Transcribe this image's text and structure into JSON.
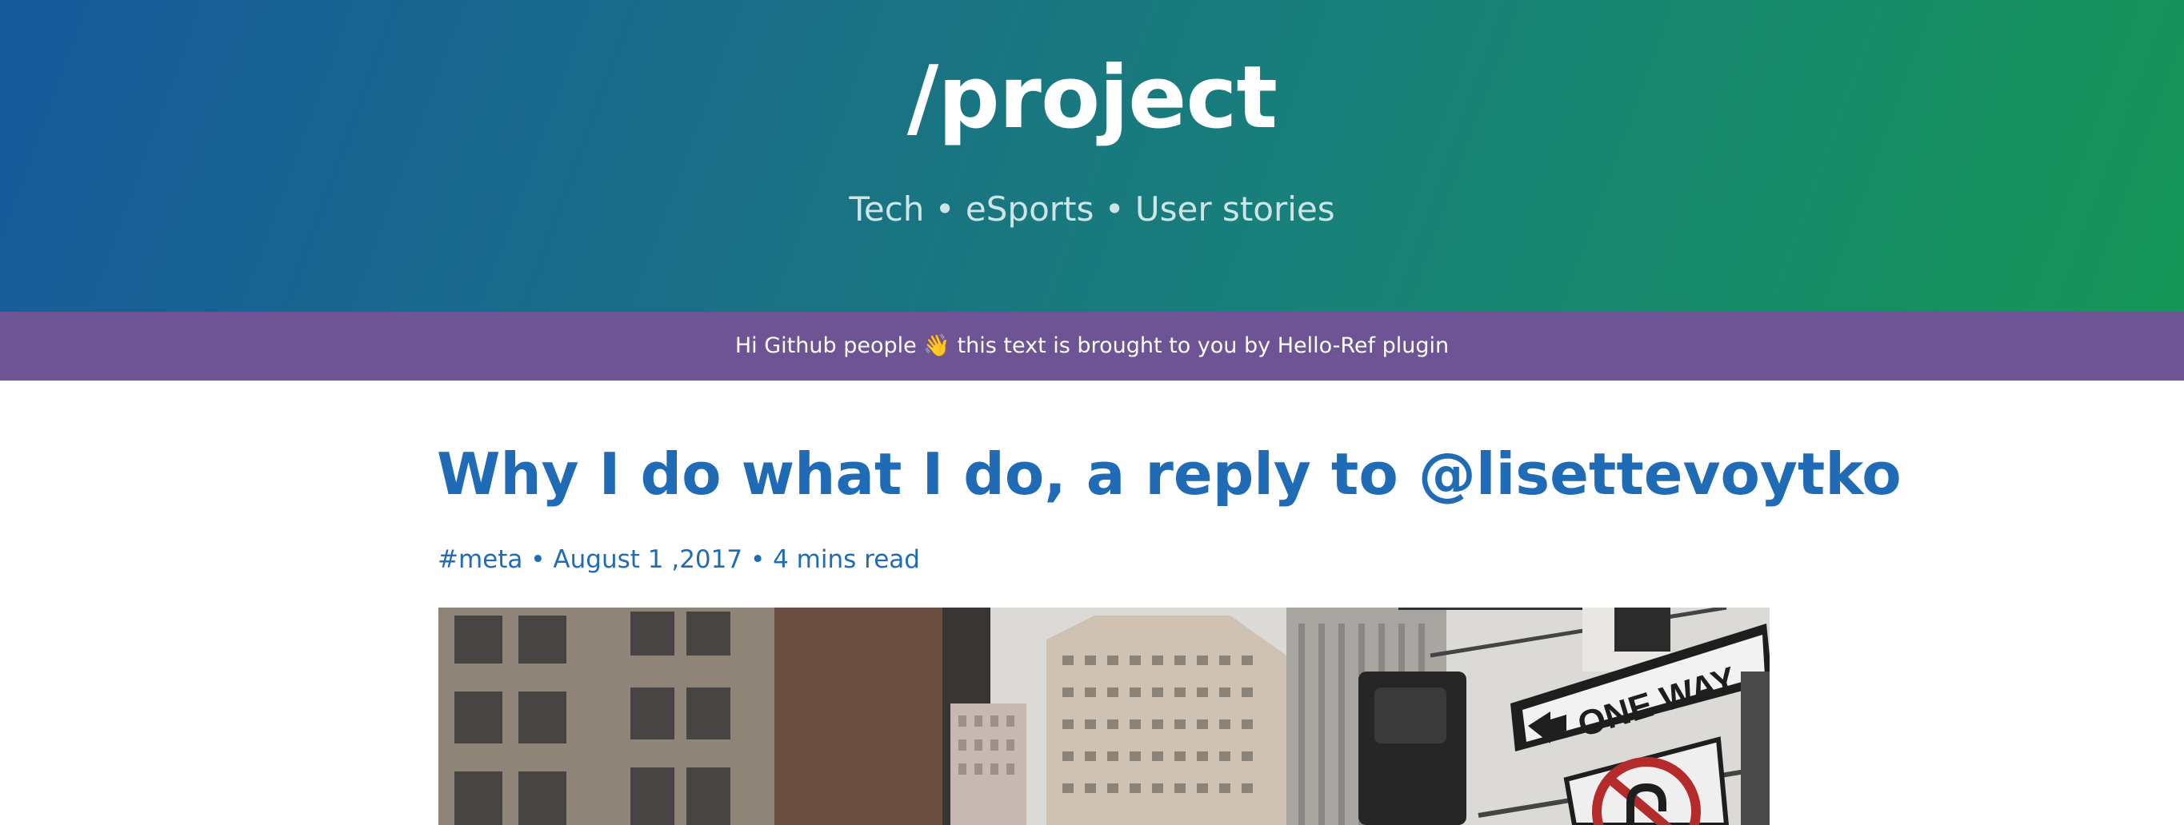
{
  "header": {
    "site_title": "/project",
    "tagline": "Tech • eSports • User stories"
  },
  "banner": {
    "text_before": "Hi Github people",
    "emoji": "👋",
    "text_after": "this text is brought to you by Hello-Ref plugin"
  },
  "post": {
    "title": "Why I do what I do, a reply to @lisettevoytko",
    "tag": "#meta",
    "separator": "•",
    "date": "August 1 ,2017",
    "read_time": "4 mins read",
    "image": {
      "sign_text": "ONE WAY"
    }
  },
  "colors": {
    "gradient_start": "#175a9c",
    "gradient_end": "#159557",
    "banner_bg": "#6e5494",
    "link_blue": "#1f6bb5"
  }
}
